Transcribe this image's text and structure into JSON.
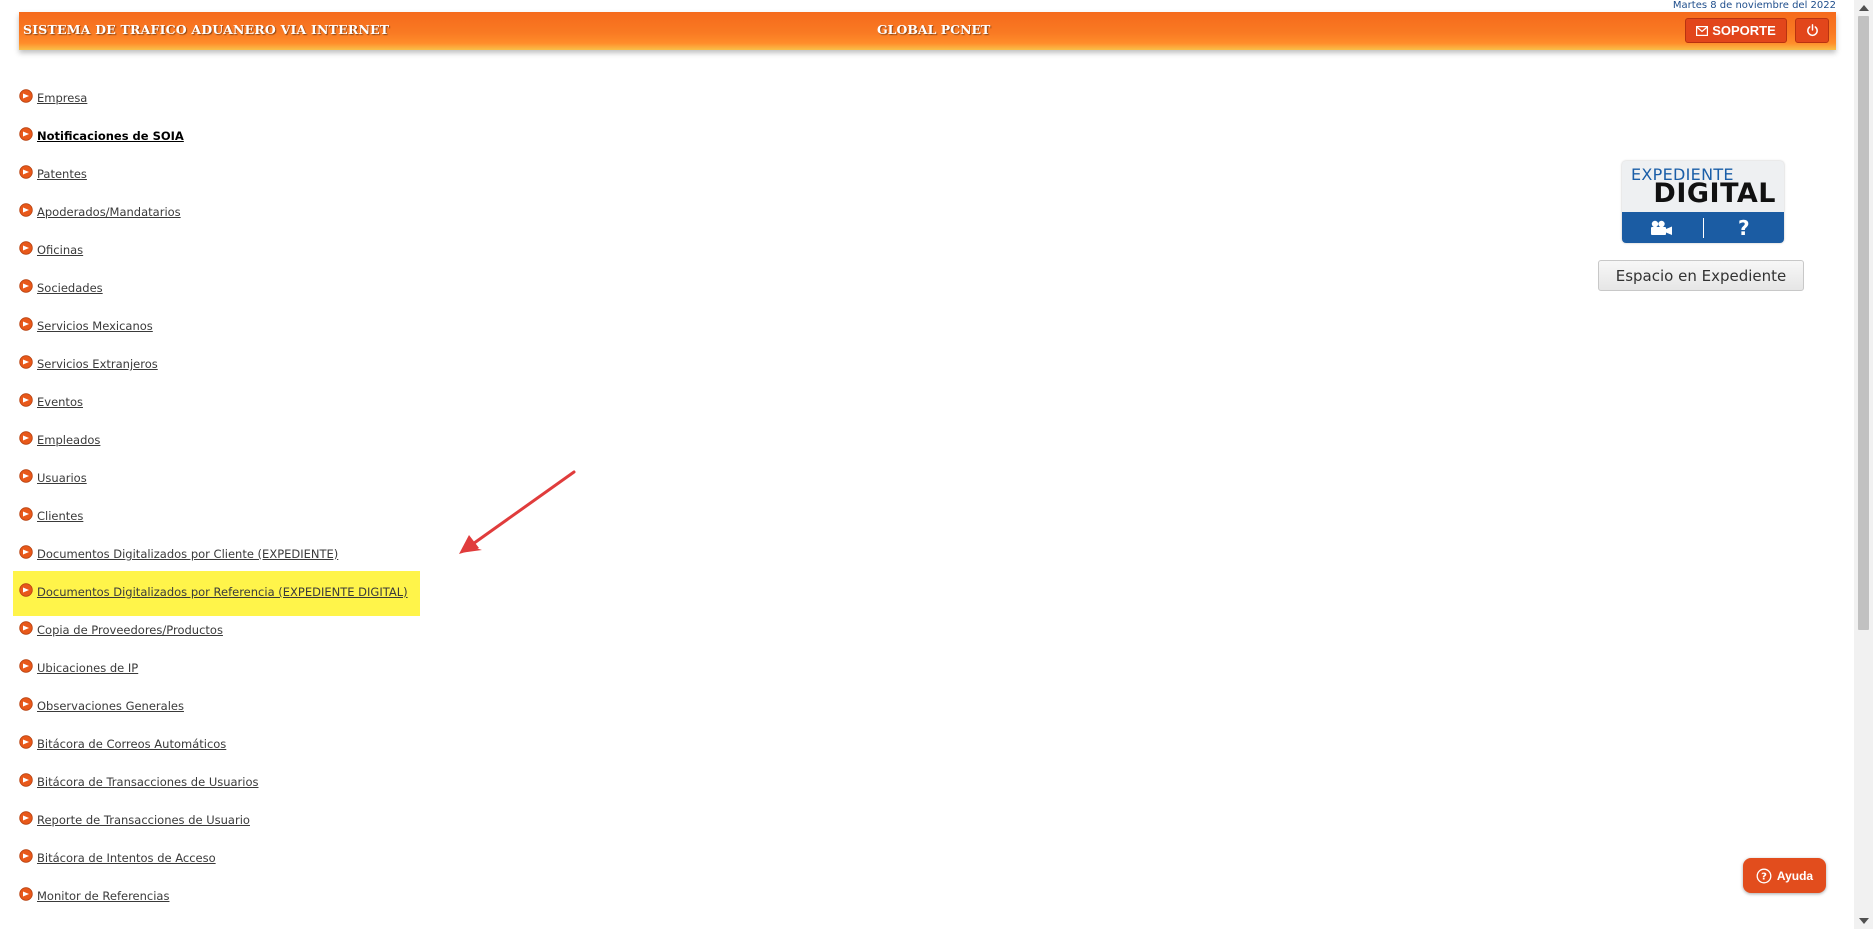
{
  "date_text": "Martes 8 de noviembre del 2022",
  "header": {
    "title": "SISTEMA DE TRAFICO ADUANERO VIA INTERNET",
    "center": "GLOBAL PCNET",
    "soporte_label": "SOPORTE"
  },
  "menu": [
    {
      "label": "Empresa",
      "bold": false
    },
    {
      "label": "Notificaciones de SOIA",
      "bold": true
    },
    {
      "label": "Patentes",
      "bold": false
    },
    {
      "label": "Apoderados/Mandatarios",
      "bold": false
    },
    {
      "label": "Oficinas",
      "bold": false
    },
    {
      "label": "Sociedades",
      "bold": false
    },
    {
      "label": "Servicios Mexicanos",
      "bold": false
    },
    {
      "label": "Servicios Extranjeros",
      "bold": false
    },
    {
      "label": "Eventos",
      "bold": false
    },
    {
      "label": "Empleados",
      "bold": false
    },
    {
      "label": "Usuarios",
      "bold": false
    },
    {
      "label": "Clientes",
      "bold": false
    },
    {
      "label": "Documentos Digitalizados por Cliente (EXPEDIENTE)",
      "bold": false
    },
    {
      "label": "Documentos Digitalizados por Referencia (EXPEDIENTE DIGITAL)",
      "bold": false,
      "highlighted": true
    },
    {
      "label": "Copia de Proveedores/Productos",
      "bold": false
    },
    {
      "label": "Ubicaciones de IP",
      "bold": false
    },
    {
      "label": "Observaciones Generales",
      "bold": false
    },
    {
      "label": "Bitácora de Correos Automáticos",
      "bold": false
    },
    {
      "label": "Bitácora de Transacciones de Usuarios",
      "bold": false
    },
    {
      "label": "Reporte de Transacciones de Usuario",
      "bold": false
    },
    {
      "label": "Bitácora de Intentos de Acceso",
      "bold": false
    },
    {
      "label": "Monitor de Referencias",
      "bold": false
    }
  ],
  "expediente_logo": {
    "line1": "EXPEDIENTE",
    "line2": "DIGITAL",
    "help_glyph": "?",
    "icons": [
      "video-camera-icon",
      "question-icon"
    ]
  },
  "espacio_button": "Espacio en Expediente",
  "ayuda_label": "Ayuda",
  "colors": {
    "header_orange": "#f97a23",
    "button_red": "#e2461b",
    "highlight": "#fff44a",
    "logo_blue": "#1b5ca3",
    "arrow_red": "#e03c3c"
  }
}
